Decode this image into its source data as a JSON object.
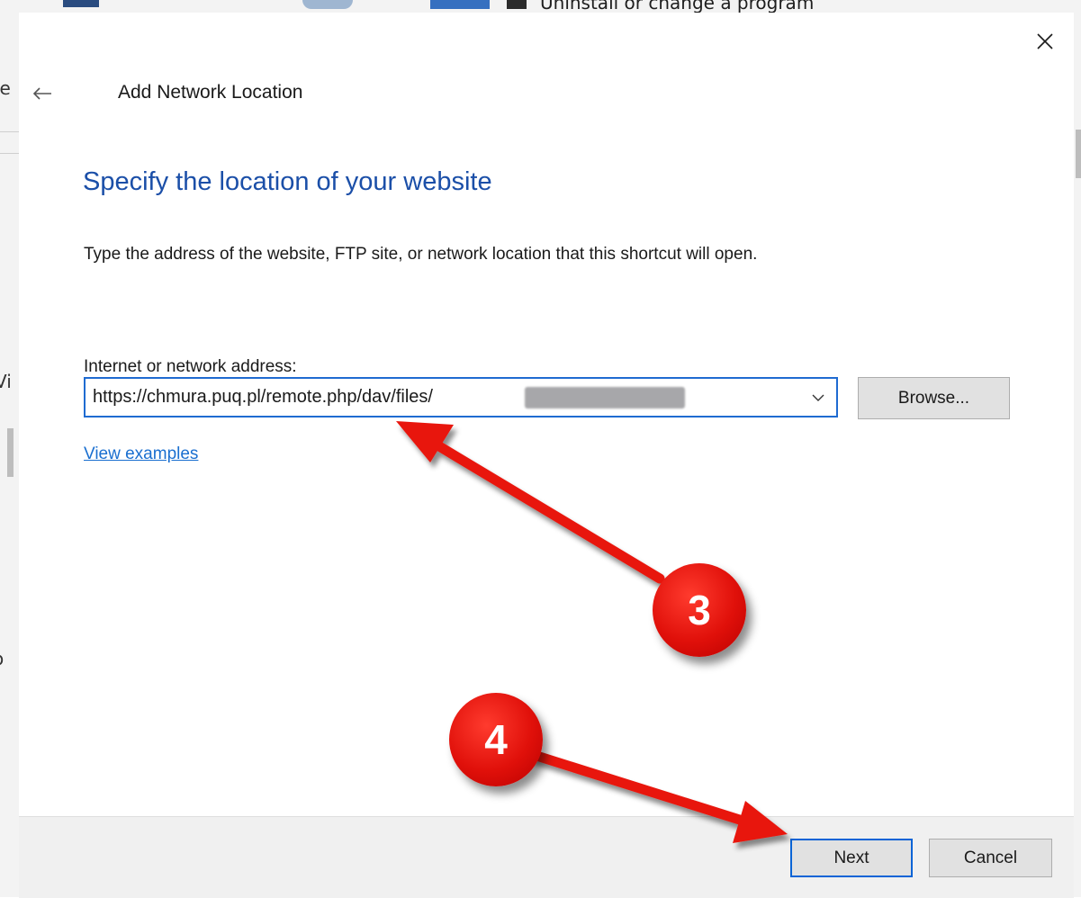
{
  "background": {
    "top_fragment_text": "Uninstall or change a program",
    "left_fragments": [
      "je",
      "Vi",
      "o"
    ]
  },
  "dialog": {
    "title": "Add Network Location",
    "heading": "Specify the location of your website",
    "description": "Type the address of the website, FTP site, or network location that this shortcut will open.",
    "address_label": "Internet or network address:",
    "address_value": "https://chmura.puq.pl/remote.php/dav/files/",
    "browse_label": "Browse...",
    "view_examples_label": "View examples",
    "next_label": "Next",
    "cancel_label": "Cancel"
  },
  "annotations": {
    "badge_3": "3",
    "badge_4": "4",
    "arrow_color": "#e8170f"
  },
  "icons": {
    "close": "close-icon",
    "back": "back-arrow-icon",
    "dropdown": "chevron-down-icon"
  },
  "colors": {
    "heading": "#1b4fa8",
    "link": "#1a6fd0",
    "focus_border": "#1f6bd1"
  }
}
